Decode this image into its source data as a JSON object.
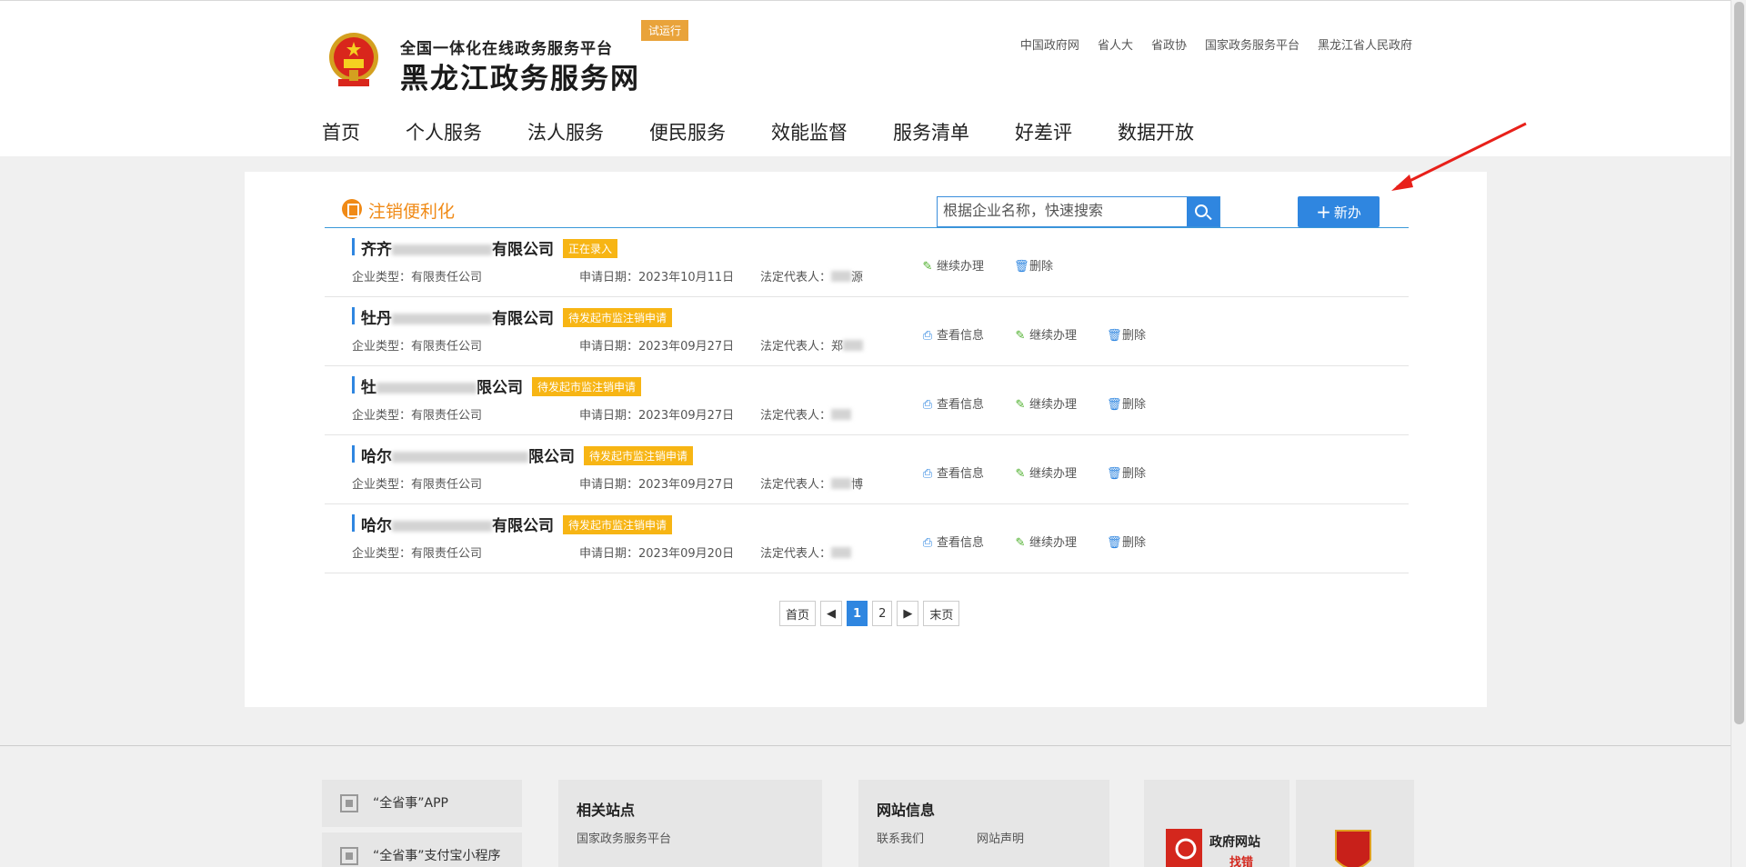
{
  "header": {
    "sub_title": "全国一体化在线政务服务平台",
    "title": "黑龙江政务服务网",
    "beta_badge": "试运行",
    "top_links": [
      "中国政府网",
      "省人大",
      "省政协",
      "国家政务服务平台",
      "黑龙江省人民政府"
    ],
    "nav": [
      "首页",
      "个人服务",
      "法人服务",
      "便民服务",
      "效能监督",
      "服务清单",
      "好差评",
      "数据开放"
    ]
  },
  "panel": {
    "title": "注销便利化",
    "search_placeholder": "根据企业名称，快速搜索",
    "new_button": "新办"
  },
  "labels": {
    "type": "企业类型：",
    "date": "申请日期：",
    "rep": "法定代表人：",
    "view": "查看信息",
    "continue": "继续办理",
    "delete": "删除"
  },
  "records": [
    {
      "name_start": "齐齐",
      "name_end": "有限公司",
      "status": "正在录入",
      "type": "有限责任公司",
      "date": "2023年10月11日",
      "rep_start": "",
      "rep_end": "源",
      "actions": [
        "continue",
        "delete"
      ]
    },
    {
      "name_start": "牡丹",
      "name_end": "有限公司",
      "status": "待发起市监注销申请",
      "type": "有限责任公司",
      "date": "2023年09月27日",
      "rep_start": "郑",
      "rep_end": "",
      "actions": [
        "view",
        "continue",
        "delete"
      ]
    },
    {
      "name_start": "牡",
      "name_end": "限公司",
      "status": "待发起市监注销申请",
      "type": "有限责任公司",
      "date": "2023年09月27日",
      "rep_start": "",
      "rep_end": "",
      "actions": [
        "view",
        "continue",
        "delete"
      ]
    },
    {
      "name_start": "哈尔",
      "name_end": "限公司",
      "status": "待发起市监注销申请",
      "type": "有限责任公司",
      "date": "2023年09月27日",
      "rep_start": "",
      "rep_end": "博",
      "actions": [
        "view",
        "continue",
        "delete"
      ]
    },
    {
      "name_start": "哈尔",
      "name_end": "有限公司",
      "status": "待发起市监注销申请",
      "type": "有限责任公司",
      "date": "2023年09月20日",
      "rep_start": "",
      "rep_end": "",
      "actions": [
        "view",
        "continue",
        "delete"
      ]
    }
  ],
  "pager": {
    "first": "首页",
    "prev": "◀",
    "pages": [
      "1",
      "2"
    ],
    "current": "1",
    "next": "▶",
    "last": "末页"
  },
  "footer": {
    "apps": [
      "“全省事”APP",
      "“全省事”支付宝小程序"
    ],
    "related": {
      "title": "相关站点",
      "links": [
        "国家政务服务平台"
      ]
    },
    "siteinfo": {
      "title": "网站信息",
      "links": [
        "联系我们",
        "网站声明"
      ]
    },
    "badge_text": "政府网站",
    "badge_sub": "找错"
  },
  "colors": {
    "accent": "#2f86e0",
    "orange": "#f08a16",
    "status": "#f7b514",
    "arrow": "#e8201a"
  }
}
